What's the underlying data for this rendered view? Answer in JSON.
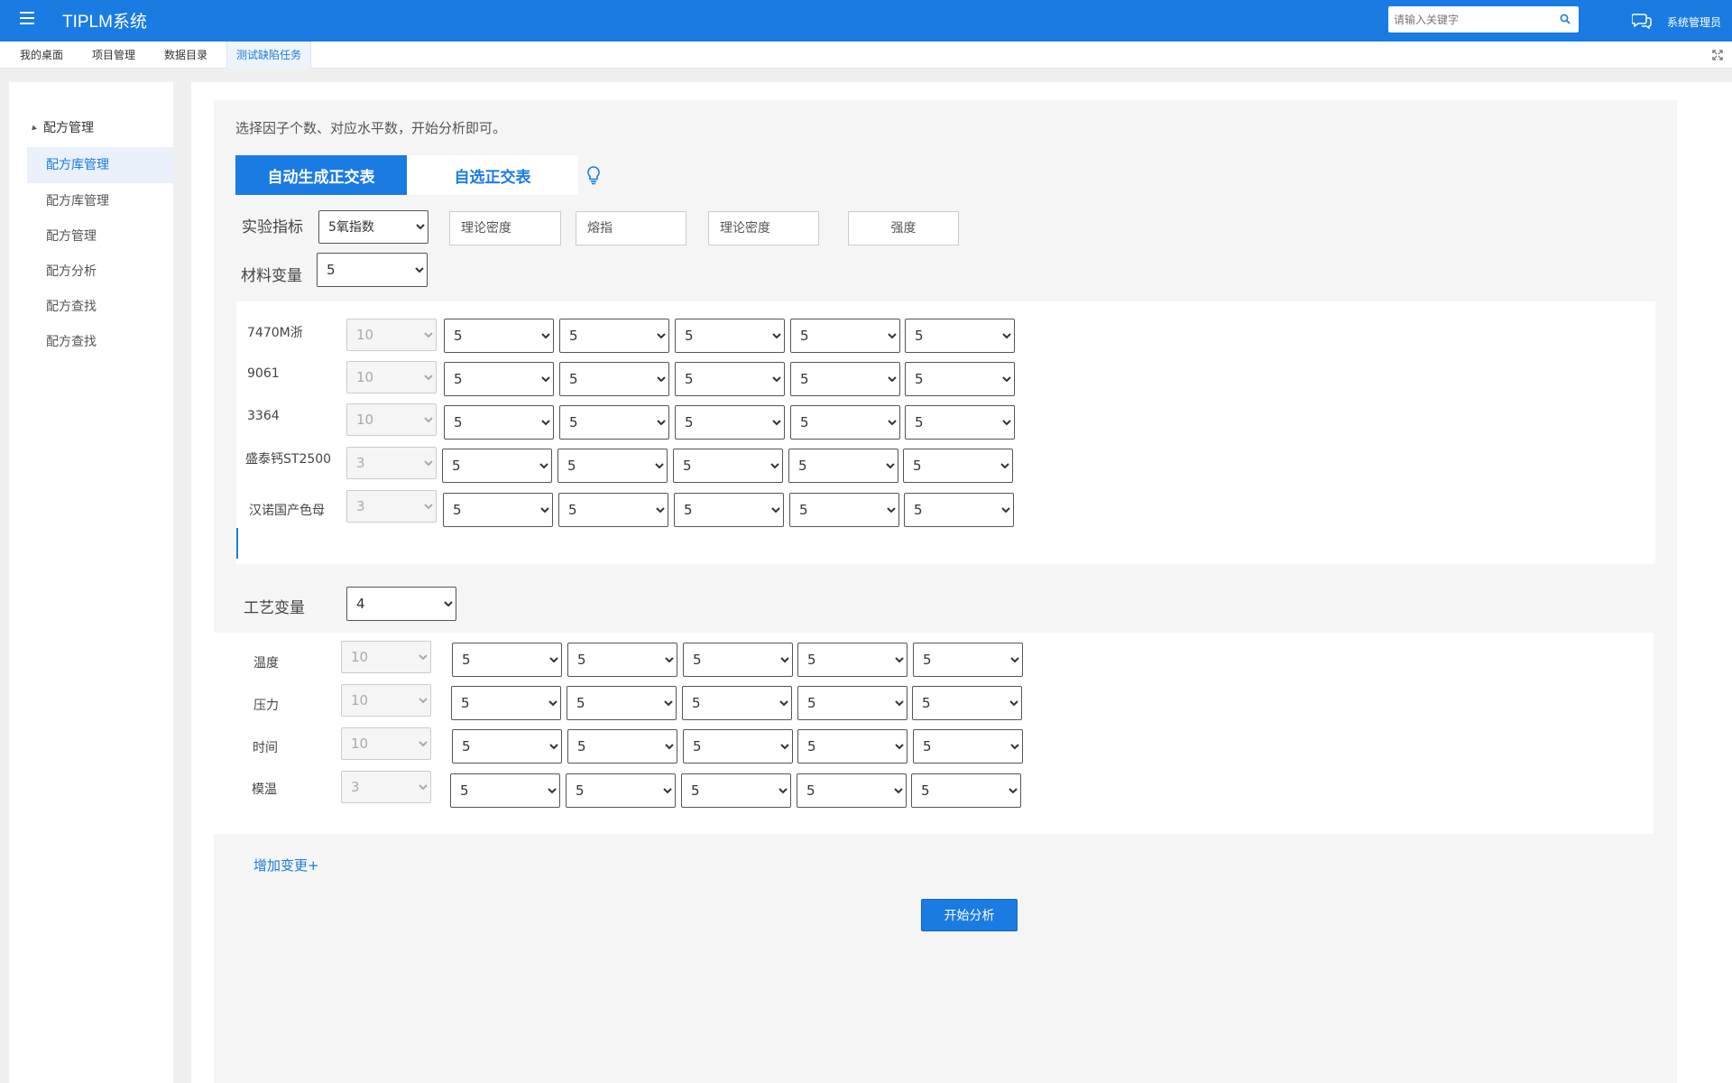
{
  "header": {
    "app_title": "TIPLM系统",
    "search_placeholder": "请输入关键字",
    "user_name": "系统管理员"
  },
  "tabs": [
    "我的桌面",
    "项目管理",
    "数据目录",
    "测试缺陷任务"
  ],
  "active_tab": "测试缺陷任务",
  "sidebar": {
    "group": "配方管理",
    "items": [
      "配方库管理",
      "配方库管理",
      "配方管理",
      "配方分析",
      "配方查找",
      "配方查找"
    ],
    "active_index": 0
  },
  "main": {
    "intro": "选择因子个数、对应水平数，开始分析即可。",
    "mode_auto": "自动生成正交表",
    "mode_manual": "自选正交表",
    "indicator_label": "实验指标",
    "indicator_select": "5氧指数",
    "indicator_boxes": [
      "理论密度",
      "熔指",
      "理论密度",
      "强度"
    ],
    "material_label": "材料变量",
    "material_count": "5",
    "materials": [
      {
        "name": "7470M浙",
        "level": "10",
        "values": [
          "5",
          "5",
          "5",
          "5",
          "5"
        ]
      },
      {
        "name": "9061",
        "level": "10",
        "values": [
          "5",
          "5",
          "5",
          "5",
          "5"
        ]
      },
      {
        "name": "3364",
        "level": "10",
        "values": [
          "5",
          "5",
          "5",
          "5",
          "5"
        ]
      },
      {
        "name": "盛泰钙ST2500",
        "level": "3",
        "values": [
          "5",
          "5",
          "5",
          "5",
          "5"
        ]
      },
      {
        "name": "汉诺国产色母",
        "level": "3",
        "values": [
          "5",
          "5",
          "5",
          "5",
          "5"
        ]
      }
    ],
    "process_label": "工艺变量",
    "process_count": "4",
    "processes": [
      {
        "name": "温度",
        "level": "10",
        "values": [
          "5",
          "5",
          "5",
          "5",
          "5"
        ]
      },
      {
        "name": "压力",
        "level": "10",
        "values": [
          "5",
          "5",
          "5",
          "5",
          "5"
        ]
      },
      {
        "name": "时间",
        "level": "10",
        "values": [
          "5",
          "5",
          "5",
          "5",
          "5"
        ]
      },
      {
        "name": "模温",
        "level": "3",
        "values": [
          "5",
          "5",
          "5",
          "5",
          "5"
        ]
      }
    ],
    "add_change": "增加变更+",
    "start_button": "开始分析"
  }
}
